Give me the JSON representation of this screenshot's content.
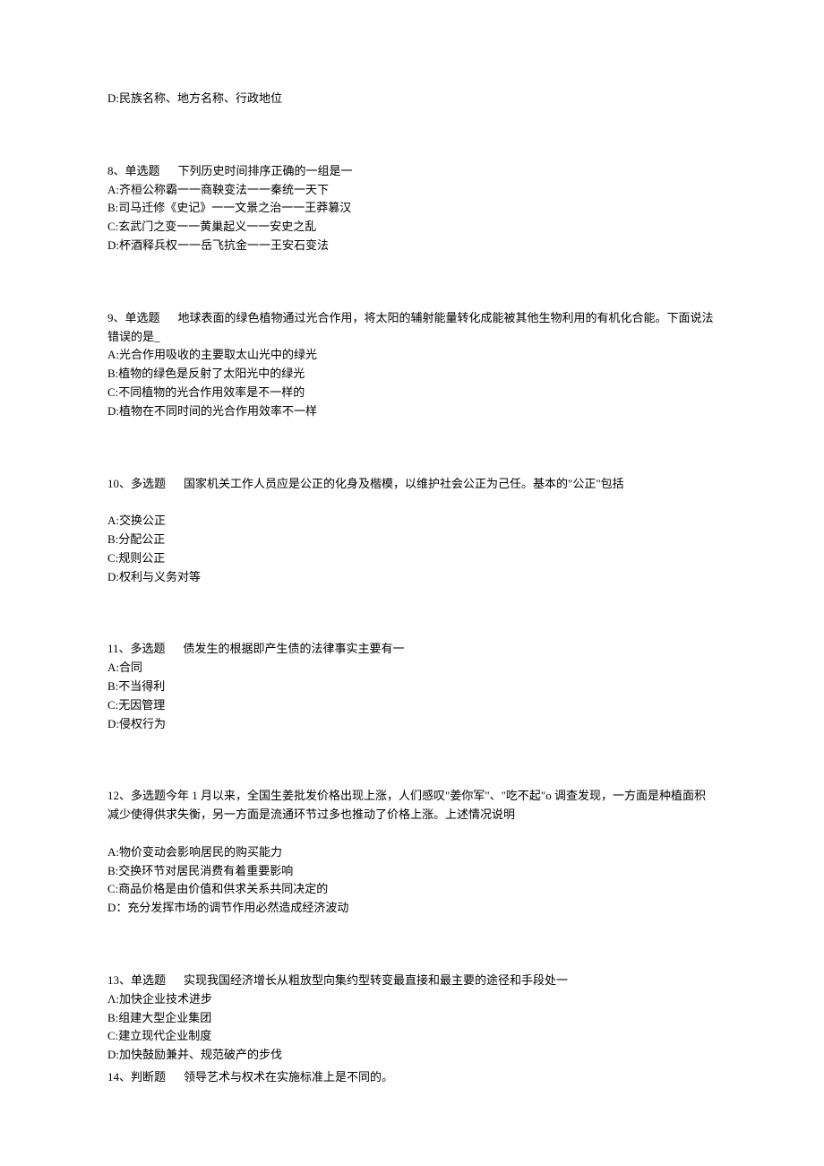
{
  "q7_tail": {
    "option_d": "D:民族名称、地方名称、行政地位"
  },
  "q8": {
    "header": "8、单选题",
    "stem": "下列历史时间排序正确的一组是一",
    "options": [
      "A:齐桓公称霸一一商鞅变法一一秦统一天下",
      "B:司马迁修《史记》一一文景之治一一王莽篡汉",
      "C:玄武门之变一一黄巢起义一一安史之乱",
      "D:杯酒释兵权一一岳飞抗金一一王安石变法"
    ]
  },
  "q9": {
    "header": "9、单选题",
    "stem": "地球表面的绿色植物通过光合作用，将太阳的辅射能量转化成能被其他生物利用的有机化合能。下面说法错误的是_",
    "options": [
      "A:光合作用吸收的主要取太山光中的绿光",
      "B:植物的绿色是反射了太阳光中的绿光",
      "C:不同植物的光合作用效率是不一样的",
      "D:植物在不同时间的光合作用效率不一样"
    ]
  },
  "q10": {
    "header": "10、多选题",
    "stem": "国家机关工作人员应是公正的化身及楷模，以维护社会公正为己任。基本的\"公正\"包括",
    "options": [
      "A:交换公正",
      "B:分配公正",
      "C:规则公正",
      "D:权利与义务对等"
    ]
  },
  "q11": {
    "header": "11、多选题",
    "stem": "债发生的根据即产生债的法律事实主要有一",
    "options": [
      "A:合同",
      "B:不当得利",
      "C:无因管理",
      "D:侵权行为"
    ]
  },
  "q12": {
    "header": "12、多选题",
    "stem": "今年 1 月以来，全国生姜批发价格出现上涨，人们感叹\"姜你军\"、\"吃不起\"o 调查发现，一方面是种植面积减少使得供求失衡，另一方面是流通环节过多也推动了价格上涨。上述情况说明",
    "options": [
      "A:物价变动会影响居民的购买能力",
      "B:交换环节对居民消费有着重要影响",
      "C:商品价格是由价值和供求关系共同决定的",
      "D：充分发挥市场的调节作用必然造成经济波动"
    ]
  },
  "q13": {
    "header": "13、单选题",
    "stem": "实现我国经济增长从粗放型向集约型转变最直接和最主要的途径和手段处一",
    "options": [
      "Λ:加快企业技术进步",
      "B:组建大型企业集团",
      "C:建立现代企业制度",
      "D:加快鼓励兼并、规范破产的步伐"
    ]
  },
  "q14": {
    "header": "14、判断题",
    "stem": "领导艺术与权术在实施标准上是不同的。"
  }
}
